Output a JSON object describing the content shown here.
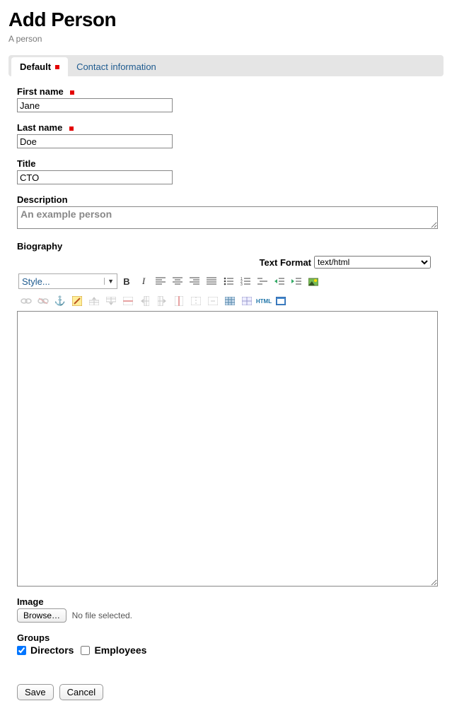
{
  "page": {
    "title": "Add Person",
    "subtitle": "A person"
  },
  "tabs": {
    "default": "Default",
    "contact": "Contact information"
  },
  "fields": {
    "first_name": {
      "label": "First name",
      "value": "Jane"
    },
    "last_name": {
      "label": "Last name",
      "value": "Doe"
    },
    "title": {
      "label": "Title",
      "value": "CTO"
    },
    "description": {
      "label": "Description",
      "value": "An example person"
    },
    "biography": {
      "label": "Biography"
    },
    "image": {
      "label": "Image",
      "browse": "Browse…",
      "status": "No file selected."
    },
    "groups": {
      "label": "Groups",
      "options": [
        {
          "label": "Directors",
          "checked": true
        },
        {
          "label": "Employees",
          "checked": false
        }
      ]
    }
  },
  "editor": {
    "text_format_label": "Text Format",
    "text_format_value": "text/html",
    "style_select": "Style..."
  },
  "actions": {
    "save": "Save",
    "cancel": "Cancel"
  }
}
